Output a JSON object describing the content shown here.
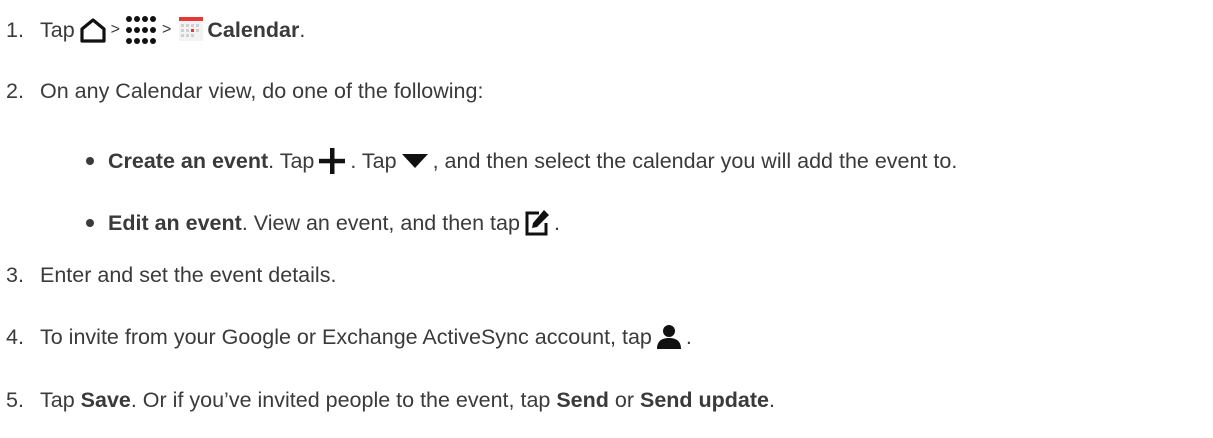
{
  "steps": [
    {
      "num": "1.",
      "parts": [
        "Tap",
        ">",
        ">",
        "Calendar",
        "."
      ]
    },
    {
      "num": "2.",
      "text": "On any Calendar view, do one of the following:"
    },
    {
      "num": "3.",
      "text": "Enter and set the event details."
    },
    {
      "num": "4.",
      "text_before": "To invite from your Google or Exchange ActiveSync account, tap",
      "text_after": "."
    },
    {
      "num": "5.",
      "p1": "Tap ",
      "b1": "Save",
      "p2": ". Or if you’ve invited people to the event, tap ",
      "b2": "Send",
      "p3": " or ",
      "b3": "Send update",
      "p4": "."
    }
  ],
  "bullets": [
    {
      "bold": "Create an event",
      "p1": ". Tap",
      "p2": ". Tap",
      "p3": ", and then select the calendar you will add the event to."
    },
    {
      "bold": "Edit an event",
      "p1": ". View an event, and then tap",
      "p2": "."
    }
  ],
  "icons": {
    "home": "home-icon",
    "apps": "all-apps-icon",
    "calendar": "calendar-app-icon",
    "add": "add-icon",
    "dropdown": "dropdown-arrow-icon",
    "edit": "edit-icon",
    "people": "people-icon"
  },
  "colors": {
    "text": "#3a3a3a",
    "calendar_accent": "#e53935"
  }
}
